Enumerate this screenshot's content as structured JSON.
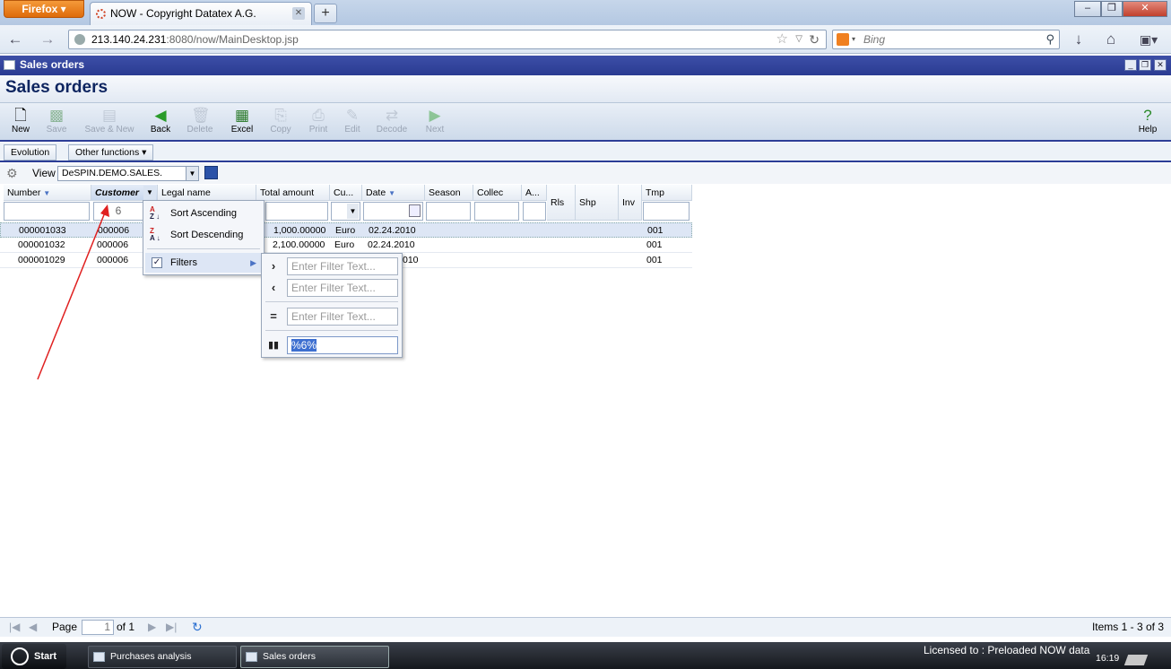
{
  "browser": {
    "menu_label": "Firefox",
    "tab_title": "NOW - Copyright Datatex A.G.",
    "url_host": "213.140.24.231",
    "url_path": ":8080/now/MainDesktop.jsp",
    "search_placeholder": "Bing"
  },
  "window": {
    "title": "Sales orders",
    "page_title": "Sales orders"
  },
  "toolbar": [
    {
      "label": "New",
      "icon": "new-doc-icon",
      "enabled": true
    },
    {
      "label": "Save",
      "icon": "save-icon",
      "enabled": false
    },
    {
      "label": "Save & New",
      "icon": "save-new-icon",
      "enabled": false
    },
    {
      "label": "Back",
      "icon": "back-arrow-icon",
      "enabled": true
    },
    {
      "label": "Delete",
      "icon": "delete-icon",
      "enabled": false
    },
    {
      "label": "Excel",
      "icon": "excel-icon",
      "enabled": true
    },
    {
      "label": "Copy",
      "icon": "copy-icon",
      "enabled": false
    },
    {
      "label": "Print",
      "icon": "print-icon",
      "enabled": false
    },
    {
      "label": "Edit",
      "icon": "edit-icon",
      "enabled": false
    },
    {
      "label": "Decode",
      "icon": "decode-icon",
      "enabled": false
    },
    {
      "label": "Next",
      "icon": "next-arrow-icon",
      "enabled": false
    },
    {
      "label": "Help",
      "icon": "help-icon",
      "enabled": true
    }
  ],
  "subbar": {
    "evolution": "Evolution",
    "other_functions": "Other functions"
  },
  "view": {
    "label": "View",
    "value": "DeSPIN.DEMO.SALES."
  },
  "grid": {
    "columns": [
      "Number",
      "Customer",
      "Legal name",
      "Total amount",
      "Cu...",
      "Date",
      "Season",
      "Collec",
      "A...",
      "Rls",
      "Shp",
      "Inv",
      "Tmp"
    ],
    "customer_filter": "6",
    "rows": [
      {
        "number": "000001033",
        "customer": "000006",
        "amount": "1,000.00000",
        "currency": "Euro",
        "date": "02.24.2010",
        "tmp": "001"
      },
      {
        "number": "000001032",
        "customer": "000006",
        "amount": "2,100.00000",
        "currency": "Euro",
        "date": "02.24.2010",
        "tmp": "001"
      },
      {
        "number": "000001029",
        "customer": "000006",
        "amount": "",
        "currency": "",
        "date": "010",
        "tmp": "001"
      }
    ]
  },
  "context_menu": {
    "sort_ascending": "Sort Ascending",
    "sort_descending": "Sort Descending",
    "filters": "Filters"
  },
  "filter_submenu": {
    "greater_placeholder": "Enter Filter Text...",
    "less_placeholder": "Enter Filter Text...",
    "equal_placeholder": "Enter Filter Text...",
    "like_value": "%6%"
  },
  "pager": {
    "page_label": "Page",
    "page_value": "1",
    "of_label": "of 1",
    "items": "Items 1 - 3 of 3"
  },
  "taskbar": {
    "start": "Start",
    "tasks": [
      "Purchases analysis",
      "Sales orders"
    ],
    "license": "Licensed to : Preloaded NOW data",
    "clock": "16:19"
  },
  "colors": {
    "accent": "#2c3e97",
    "title_text": "#0e2560",
    "annotation_arrow": "#e02020"
  }
}
